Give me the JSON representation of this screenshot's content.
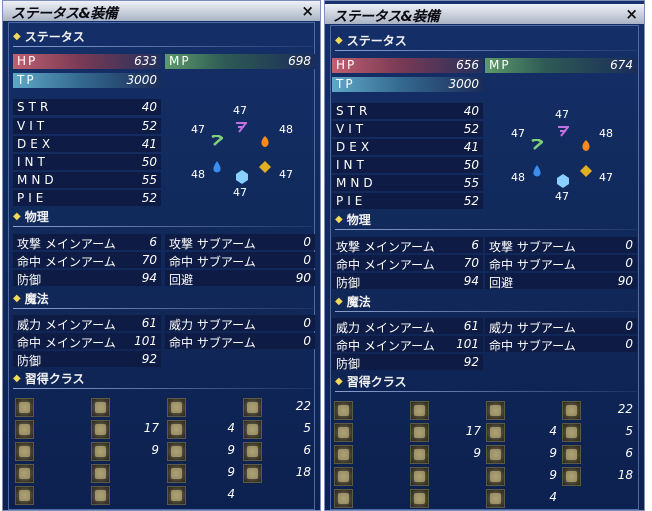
{
  "panels": [
    {
      "title": "ステータス&装備",
      "close": "×",
      "status_header": "ステータス",
      "hp_label": "HP",
      "hp": "633",
      "mp_label": "MP",
      "mp": "698",
      "tp_label": "TP",
      "tp": "3000",
      "stats": [
        {
          "label": "STR",
          "value": "40"
        },
        {
          "label": "VIT",
          "value": "52"
        },
        {
          "label": "DEX",
          "value": "41"
        },
        {
          "label": "INT",
          "value": "50"
        },
        {
          "label": "MND",
          "value": "55"
        },
        {
          "label": "PIE",
          "value": "52"
        }
      ],
      "elements": {
        "wind": "47",
        "lightning": "47",
        "fire": "48",
        "water": "48",
        "earth": "47",
        "ice": "47"
      },
      "physical_header": "物理",
      "physical": [
        {
          "label": "攻撃 メインアーム",
          "value": "6"
        },
        {
          "label": "攻撃 サブアーム",
          "value": "0"
        },
        {
          "label": "命中 メインアーム",
          "value": "70"
        },
        {
          "label": "命中 サブアーム",
          "value": "0"
        },
        {
          "label": "防御",
          "value": "94"
        },
        {
          "label": "回避",
          "value": "90"
        }
      ],
      "magic_header": "魔法",
      "magic": [
        {
          "label": "威力 メインアーム",
          "value": "61"
        },
        {
          "label": "威力 サブアーム",
          "value": "0"
        },
        {
          "label": "命中 メインアーム",
          "value": "101"
        },
        {
          "label": "命中 サブアーム",
          "value": "0"
        },
        {
          "label": "防御",
          "value": "92"
        }
      ],
      "classes_header": "習得クラス",
      "class_levels": [
        [
          "",
          "",
          "",
          "22"
        ],
        [
          "",
          "17",
          "4",
          "5"
        ],
        [
          "",
          "9",
          "9",
          "6"
        ],
        [
          "",
          "",
          "9",
          "18"
        ],
        [
          "",
          "",
          "4",
          ""
        ]
      ]
    },
    {
      "title": "ステータス&装備",
      "close": "×",
      "status_header": "ステータス",
      "hp_label": "HP",
      "hp": "656",
      "mp_label": "MP",
      "mp": "674",
      "tp_label": "TP",
      "tp": "3000",
      "stats": [
        {
          "label": "STR",
          "value": "40"
        },
        {
          "label": "VIT",
          "value": "52"
        },
        {
          "label": "DEX",
          "value": "41"
        },
        {
          "label": "INT",
          "value": "50"
        },
        {
          "label": "MND",
          "value": "55"
        },
        {
          "label": "PIE",
          "value": "52"
        }
      ],
      "elements": {
        "wind": "47",
        "lightning": "47",
        "fire": "48",
        "water": "48",
        "earth": "47",
        "ice": "47"
      },
      "physical_header": "物理",
      "physical": [
        {
          "label": "攻撃 メインアーム",
          "value": "6"
        },
        {
          "label": "攻撃 サブアーム",
          "value": "0"
        },
        {
          "label": "命中 メインアーム",
          "value": "70"
        },
        {
          "label": "命中 サブアーム",
          "value": "0"
        },
        {
          "label": "防御",
          "value": "94"
        },
        {
          "label": "回避",
          "value": "90"
        }
      ],
      "magic_header": "魔法",
      "magic": [
        {
          "label": "威力 メインアーム",
          "value": "61"
        },
        {
          "label": "威力 サブアーム",
          "value": "0"
        },
        {
          "label": "命中 メインアーム",
          "value": "101"
        },
        {
          "label": "命中 サブアーム",
          "value": "0"
        },
        {
          "label": "防御",
          "value": "92"
        }
      ],
      "classes_header": "習得クラス",
      "class_levels": [
        [
          "",
          "",
          "",
          "22"
        ],
        [
          "",
          "17",
          "4",
          "5"
        ],
        [
          "",
          "9",
          "9",
          "6"
        ],
        [
          "",
          "",
          "9",
          "18"
        ],
        [
          "",
          "",
          "4",
          ""
        ]
      ]
    }
  ],
  "colors": {
    "panel_bg": "#112a5c",
    "title_bar": "#d4d9e4",
    "header_diamond": "#f2d95a",
    "hp_bar": "#c06070",
    "mp_bar": "#5e9a6a",
    "tp_bar": "#5fa8c8",
    "wind_icon": "#7fd07a",
    "lightning_icon": "#c070e0",
    "fire_icon": "#ff8a1a",
    "water_icon": "#3a8ef0",
    "earth_icon": "#e0b020",
    "ice_icon": "#8ad0ff"
  },
  "icons": [
    "close-icon",
    "diamond-bullet-icon",
    "wind-icon",
    "lightning-icon",
    "fire-icon",
    "water-icon",
    "earth-icon",
    "ice-icon",
    "class-job-icon"
  ]
}
